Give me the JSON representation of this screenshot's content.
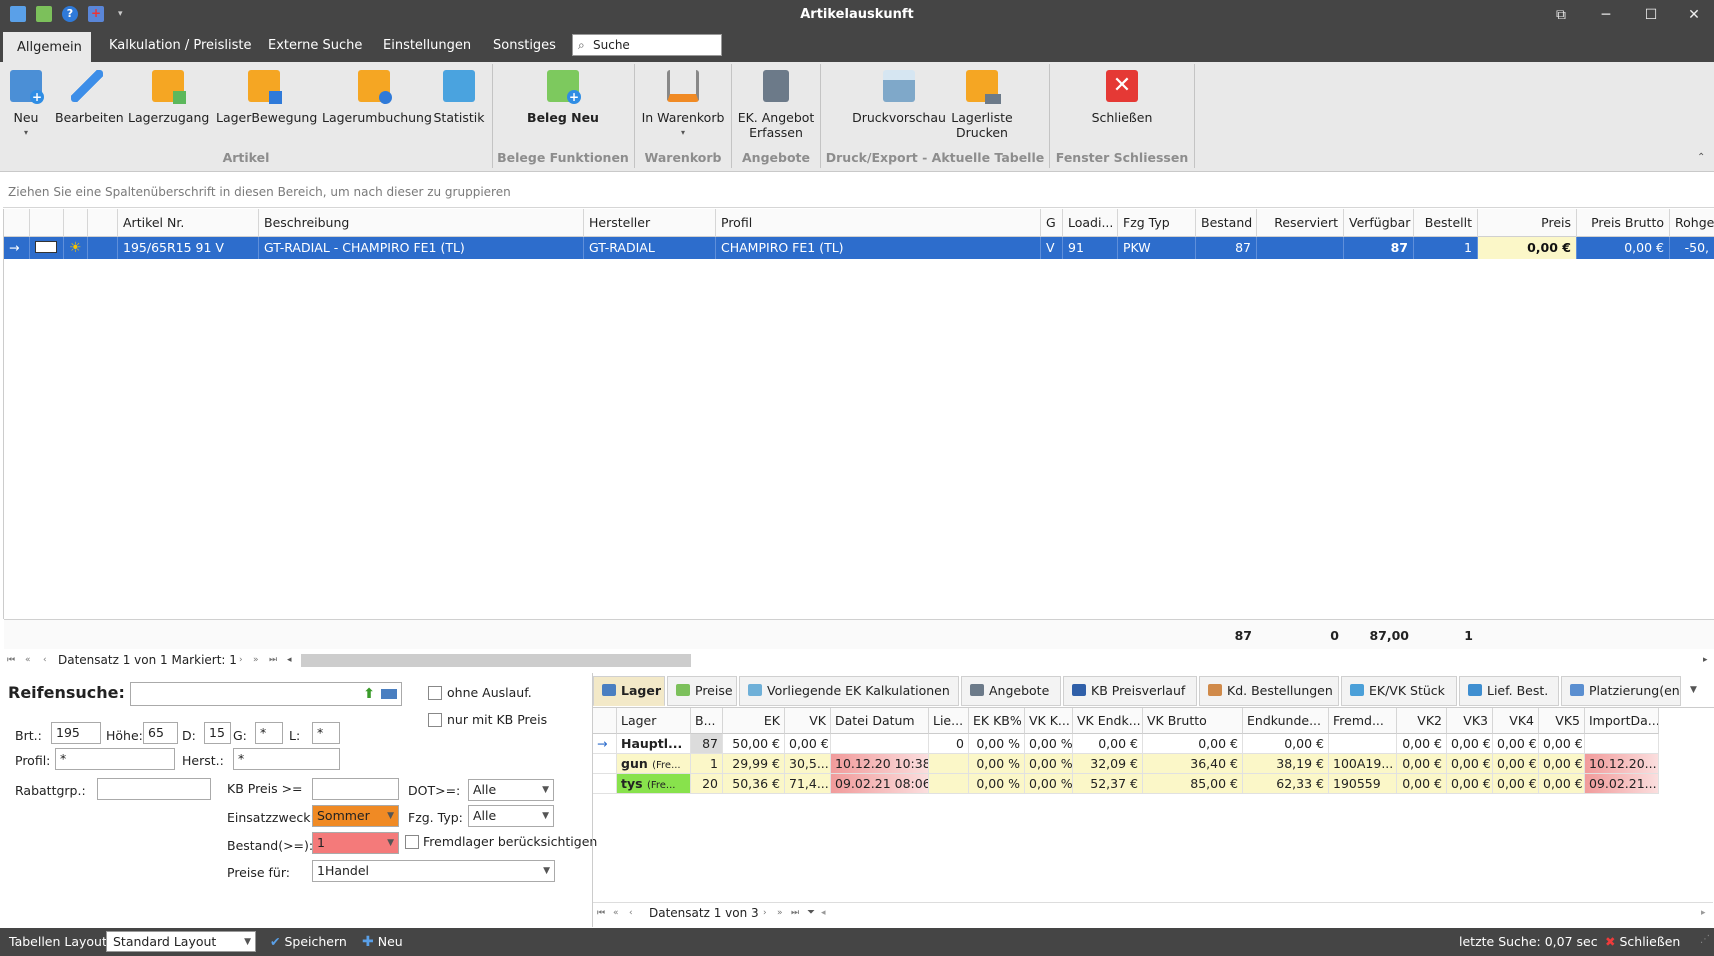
{
  "window": {
    "title": "Artikelauskunft"
  },
  "menu": {
    "tabs": [
      "Allgemein",
      "Kalkulation / Preisliste",
      "Externe Suche",
      "Einstellungen",
      "Sonstiges"
    ],
    "search_placeholder": "Suche"
  },
  "ribbon": {
    "buttons": {
      "neu": "Neu",
      "bearbeiten": "Bearbeiten",
      "lagerzugang": "Lagerzugang",
      "lagerbewegung": "LagerBewegung",
      "lagerumbuchung": "Lagerumbuchung",
      "statistik": "Statistik",
      "beleg_neu": "Beleg Neu",
      "in_warenkorb": "In Warenkorb",
      "ek_angebot_1": "EK. Angebot",
      "ek_angebot_2": "Erfassen",
      "druckvorschau": "Druckvorschau",
      "lagerliste_1": "Lagerliste",
      "lagerliste_2": "Drucken",
      "schliessen": "Schließen"
    },
    "groups": [
      "Artikel",
      "Belege Funktionen",
      "Warenkorb",
      "Angebote",
      "Druck/Export - Aktuelle Tabelle",
      "Fenster Schliessen"
    ]
  },
  "grid": {
    "group_hint": "Ziehen Sie eine Spaltenüberschrift in diesen Bereich, um nach dieser zu gruppieren",
    "columns": [
      "Artikel Nr.",
      "Beschreibung",
      "Hersteller",
      "Profil",
      "G",
      "Loadi...",
      "Fzg Typ",
      "Bestand",
      "Reserviert",
      "Verfügbar",
      "Bestellt",
      "Preis",
      "Preis Brutto",
      "Rohgew"
    ],
    "row": {
      "artikel_nr": "195/65R15 91 V",
      "beschreibung": "GT-RADIAL - CHAMPIRO FE1 (TL)",
      "hersteller": "GT-RADIAL",
      "profil": "CHAMPIRO FE1 (TL)",
      "g": "V",
      "load": "91",
      "fzg_typ": "PKW",
      "bestand": "87",
      "reserviert": "",
      "verfuegbar": "87",
      "bestellt": "1",
      "preis": "0,00 €",
      "preis_brutto": "0,00 €",
      "rohgew": "-50,"
    },
    "totals": {
      "bestand": "87",
      "reserviert": "0",
      "verfuegbar": "87,00",
      "bestellt": "1"
    },
    "navigator": "Datensatz 1 von 1 Markiert: 1"
  },
  "search": {
    "title": "Reifensuche:",
    "ohne_auslauf": "ohne Auslauf.",
    "nur_kb_preis": "nur mit KB Preis",
    "brt_label": "Brt.:",
    "brt": "195",
    "hoehe_label": "Höhe:",
    "hoehe": "65",
    "d_label": "D:",
    "d": "15",
    "g_label": "G:",
    "g": "*",
    "l_label": "L:",
    "l": "*",
    "profil_label": "Profil:",
    "profil": "*",
    "herst_label": "Herst.:",
    "herst": "*",
    "rabatt_label": "Rabattgrp.:",
    "kb_preis_label": "KB Preis >=",
    "dot_label": "DOT>=:",
    "dot": "Alle",
    "einsatz_label": "Einsatzzweck:",
    "einsatz": "Sommer",
    "fzg_label": "Fzg. Typ:",
    "fzg": "Alle",
    "bestand_label": "Bestand(>=):",
    "bestand": "1",
    "fremdlager": "Fremdlager berücksichtigen",
    "preise_label": "Preise für:",
    "preise": "1Handel"
  },
  "details": {
    "tabs": [
      "Lager",
      "Preise",
      "Vorliegende EK Kalkulationen",
      "Angebote",
      "KB Preisverlauf",
      "Kd. Bestellungen",
      "EK/VK Stück",
      "Lief. Best.",
      "Platzierung(en)"
    ],
    "columns": [
      "Lager",
      "B...",
      "EK",
      "VK",
      "Datei Datum",
      "Lie...",
      "EK KB%",
      "VK K...",
      "VK Endk...",
      "VK Brutto",
      "Endkunde...",
      "Fremd...",
      "VK2",
      "VK3",
      "VK4",
      "VK5",
      "ImportDa..."
    ],
    "rows": [
      {
        "lager": "Hauptl...",
        "lager_sub": "",
        "b": "87",
        "ek": "50,00 €",
        "vk": "0,00 €",
        "datum": "",
        "lie": "0",
        "ekkb": "0,00 %",
        "vkk": "0,00 %",
        "vkendk": "0,00 €",
        "vkbrutto": "0,00 €",
        "endkunde": "0,00 €",
        "fremd": "",
        "vk2": "0,00 €",
        "vk3": "0,00 €",
        "vk4": "0,00 €",
        "vk5": "0,00 €",
        "import": ""
      },
      {
        "lager": "gun",
        "lager_sub": "(Fre...",
        "b": "1",
        "ek": "29,99 €",
        "vk": "30,5...",
        "datum": "10.12.20 10:38",
        "lie": "",
        "ekkb": "0,00 %",
        "vkk": "0,00 %",
        "vkendk": "32,09 €",
        "vkbrutto": "36,40 €",
        "endkunde": "38,19 €",
        "fremd": "100A19...",
        "vk2": "0,00 €",
        "vk3": "0,00 €",
        "vk4": "0,00 €",
        "vk5": "0,00 €",
        "import": "10.12.20..."
      },
      {
        "lager": "tys",
        "lager_sub": "(Fre...",
        "b": "20",
        "ek": "50,36 €",
        "vk": "71,4...",
        "datum": "09.02.21 08:06",
        "lie": "",
        "ekkb": "0,00 %",
        "vkk": "0,00 %",
        "vkendk": "52,37 €",
        "vkbrutto": "85,00 €",
        "endkunde": "62,33 €",
        "fremd": "190559",
        "vk2": "0,00 €",
        "vk3": "0,00 €",
        "vk4": "0,00 €",
        "vk5": "0,00 €",
        "import": "09.02.21..."
      }
    ],
    "navigator": "Datensatz 1 von 3"
  },
  "status": {
    "layout_label": "Tabellen Layout:",
    "layout_value": "Standard Layout",
    "save": "Speichern",
    "new": "Neu",
    "last_search": "letzte Suche: 0,07 sec",
    "close": "Schließen"
  },
  "colors": {
    "accent": "#2d6dcc",
    "chrome": "#454545",
    "ribbon": "#e9e9e9",
    "highlight": "#fbf7c8",
    "warning": "#f47a7a"
  }
}
